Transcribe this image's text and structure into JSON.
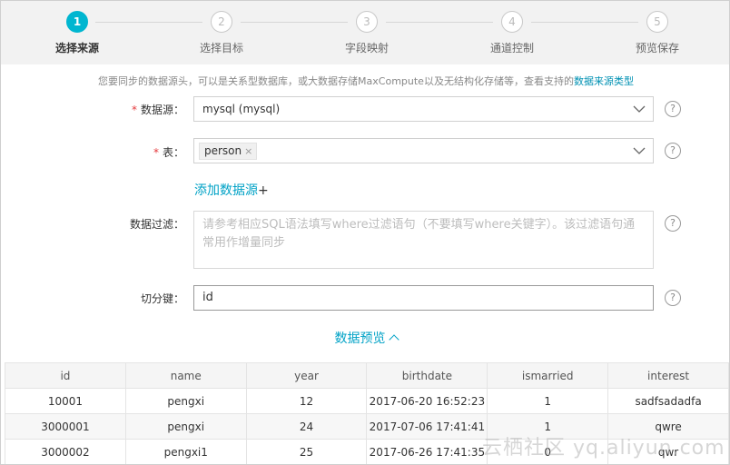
{
  "stepper": {
    "steps": [
      {
        "number": "1",
        "label": "选择来源"
      },
      {
        "number": "2",
        "label": "选择目标"
      },
      {
        "number": "3",
        "label": "字段映射"
      },
      {
        "number": "4",
        "label": "通道控制"
      },
      {
        "number": "5",
        "label": "预览保存"
      }
    ],
    "active_step": 1
  },
  "info": {
    "text": "您要同步的数据源头，可以是关系型数据库，或大数据存储MaxCompute以及无结构化存储等，查看支持的",
    "link": "数据来源类型"
  },
  "form": {
    "datasource": {
      "required_mark": "*",
      "label": "数据源：",
      "value": "mysql (mysql)"
    },
    "table": {
      "required_mark": "*",
      "label": "表：",
      "tag": "person",
      "tag_remove": "×"
    },
    "add_source": {
      "label": "添加数据源",
      "plus": "+"
    },
    "filter": {
      "label": "数据过滤：",
      "placeholder": "请参考相应SQL语法填写where过滤语句（不要填写where关键字）。该过滤语句通常用作增量同步"
    },
    "split_key": {
      "label": "切分键：",
      "value": "id"
    },
    "help_glyph": "?"
  },
  "preview": {
    "label": "数据预览"
  },
  "table_data": {
    "columns": [
      "id",
      "name",
      "year",
      "birthdate",
      "ismarried",
      "interest"
    ],
    "rows": [
      [
        "10001",
        "pengxi",
        "12",
        "2017-06-20 16:52:23",
        "1",
        "sadfsadadfa"
      ],
      [
        "3000001",
        "pengxi",
        "24",
        "2017-07-06 17:41:41",
        "1",
        "qwre"
      ],
      [
        "3000002",
        "pengxi1",
        "25",
        "2017-06-26 17:41:35",
        "0",
        "qwr"
      ]
    ]
  },
  "watermark": "云栖社区 yq.aliyun.com",
  "colors": {
    "accent": "#00b6d0",
    "link": "#00a2c6",
    "required": "#e4393c"
  }
}
